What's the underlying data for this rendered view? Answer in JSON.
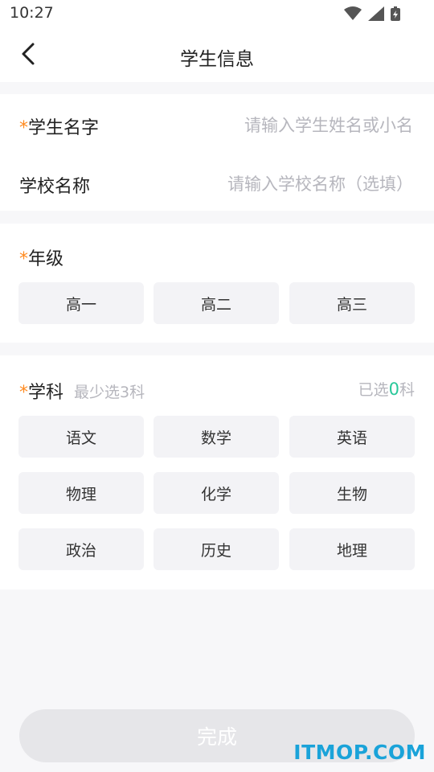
{
  "status_bar": {
    "time": "10:27"
  },
  "nav": {
    "title": "学生信息"
  },
  "basic": {
    "student_name": {
      "star": "*",
      "label": "学生名字",
      "placeholder": "请输入学生姓名或小名"
    },
    "school_name": {
      "label": "学校名称",
      "placeholder": "请输入学校名称（选填）"
    }
  },
  "grade": {
    "star": "*",
    "label": "年级",
    "options": [
      "高一",
      "高二",
      "高三"
    ]
  },
  "subject": {
    "star": "*",
    "label": "学科",
    "hint": "最少选3科",
    "selected_prefix": "已选",
    "selected_count": "0",
    "selected_suffix": "科",
    "options": [
      "语文",
      "数学",
      "英语",
      "物理",
      "化学",
      "生物",
      "政治",
      "历史",
      "地理"
    ]
  },
  "footer": {
    "done_label": "完成"
  },
  "watermark": "ITMOP.COM",
  "colors": {
    "accent_star": "#ff8a1f",
    "count": "#28c89a",
    "disabled_button": "#e6e6e9"
  }
}
